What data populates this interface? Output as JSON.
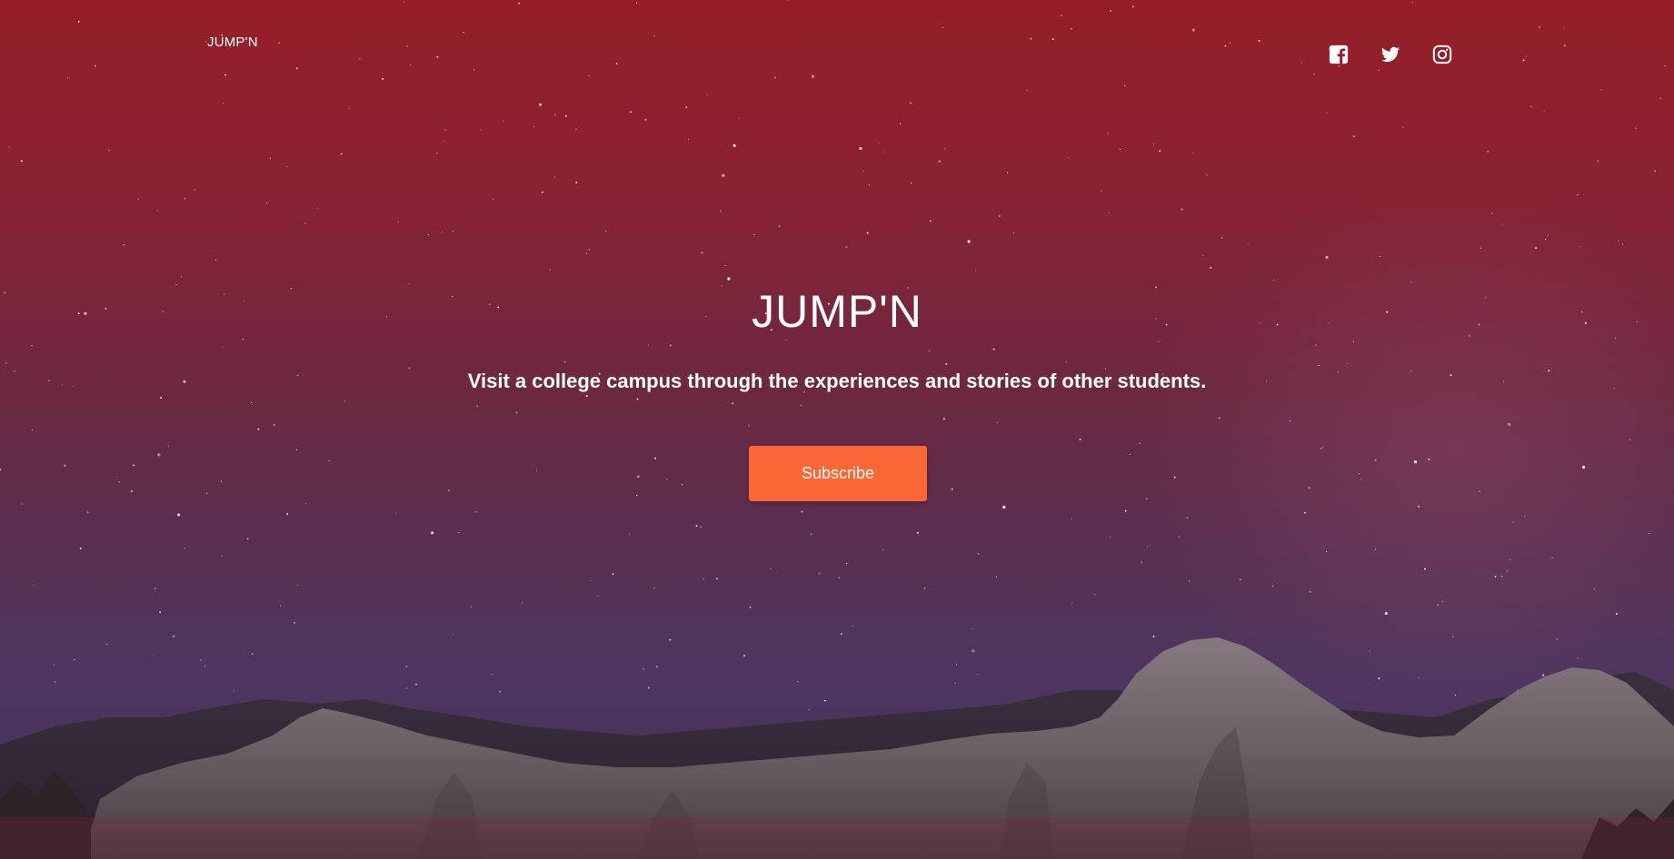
{
  "header": {
    "brand": "JUMP'N",
    "social": [
      {
        "name": "facebook-icon"
      },
      {
        "name": "twitter-icon"
      },
      {
        "name": "instagram-icon"
      }
    ]
  },
  "hero": {
    "title": "JUMP'N",
    "tagline": "Visit a college campus through the experiences and stories of other students.",
    "cta_label": "Subscribe",
    "background_image": "starry night sky over granite mountains"
  },
  "colors": {
    "sky_top": "#951e27",
    "sky_bottom": "#4d3660",
    "cta": "#fc6736",
    "text": "#ffffff"
  }
}
